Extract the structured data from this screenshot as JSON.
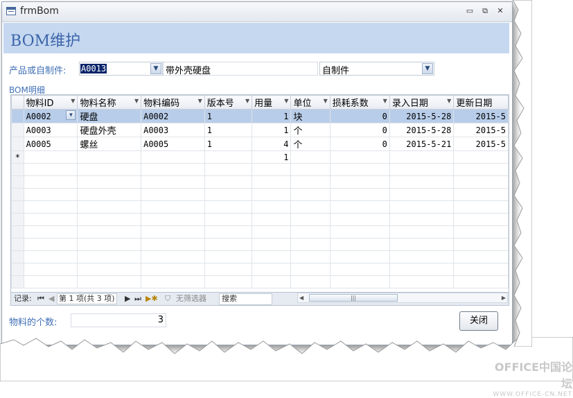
{
  "window": {
    "title": "frmBom"
  },
  "form": {
    "heading": "BOM维护",
    "product_label": "产品或自制件:",
    "product_code": "A0013",
    "product_name": "带外壳硬盘",
    "product_type": "自制件",
    "detail_label": "BOM明细",
    "count_label": "物料的个数:",
    "count_value": "3",
    "close_label": "关闭"
  },
  "grid": {
    "columns": [
      "物料ID",
      "物料名称",
      "物料编码",
      "版本号",
      "用量",
      "单位",
      "损耗系数",
      "录入日期",
      "更新日期"
    ],
    "rows": [
      [
        "A0002",
        "硬盘",
        "A0002",
        "1",
        "1",
        "块",
        "0",
        "2015-5-28",
        "2015-5"
      ],
      [
        "A0003",
        "硬盘外壳",
        "A0003",
        "1",
        "1",
        "个",
        "0",
        "2015-5-28",
        "2015-5"
      ],
      [
        "A0005",
        "螺丝",
        "A0005",
        "1",
        "4",
        "个",
        "0",
        "2015-5-21",
        "2015-5"
      ]
    ],
    "new_row_marker": "*",
    "new_row_qty": "1"
  },
  "navigator": {
    "record_label": "记录:",
    "position": "第 1 项(共 3 项)",
    "filter_label": "无筛选器",
    "search_label": "搜索"
  },
  "watermark": {
    "line1": "OFFICE中国论坛",
    "line2": "WWW.OFFICE-CN.NET"
  },
  "colors": {
    "header_band": "#c5d8f0",
    "heading_text": "#3c64a8",
    "current_row": "#b8cde9"
  }
}
